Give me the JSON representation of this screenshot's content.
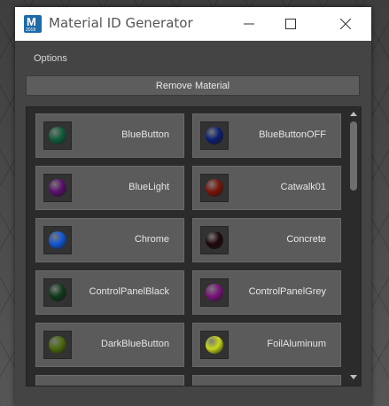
{
  "window": {
    "title": "Material ID Generator",
    "app_icon_letter": "M",
    "app_icon_sub": "2018"
  },
  "menu": {
    "options_label": "Options"
  },
  "toolbar": {
    "remove_label": "Remove Material"
  },
  "materials": [
    {
      "name": "BlueButton",
      "color": "#0f5e3a"
    },
    {
      "name": "BlueButtonOFF",
      "color": "#0c1f73"
    },
    {
      "name": "BlueLight",
      "color": "#5a0f6e"
    },
    {
      "name": "Catwalk01",
      "color": "#7a1408"
    },
    {
      "name": "Chrome",
      "color": "#1157d6"
    },
    {
      "name": "Concrete",
      "color": "#1d070b"
    },
    {
      "name": "ControlPanelBlack",
      "color": "#0d3a1a"
    },
    {
      "name": "ControlPanelGrey",
      "color": "#7a137e"
    },
    {
      "name": "DarkBlueButton",
      "color": "#4a6a0a"
    },
    {
      "name": "FoilAluminum",
      "color": "#c8d81a"
    },
    {
      "name": "",
      "color": "#5b5b5b"
    },
    {
      "name": "",
      "color": "#5b5b5b"
    }
  ]
}
